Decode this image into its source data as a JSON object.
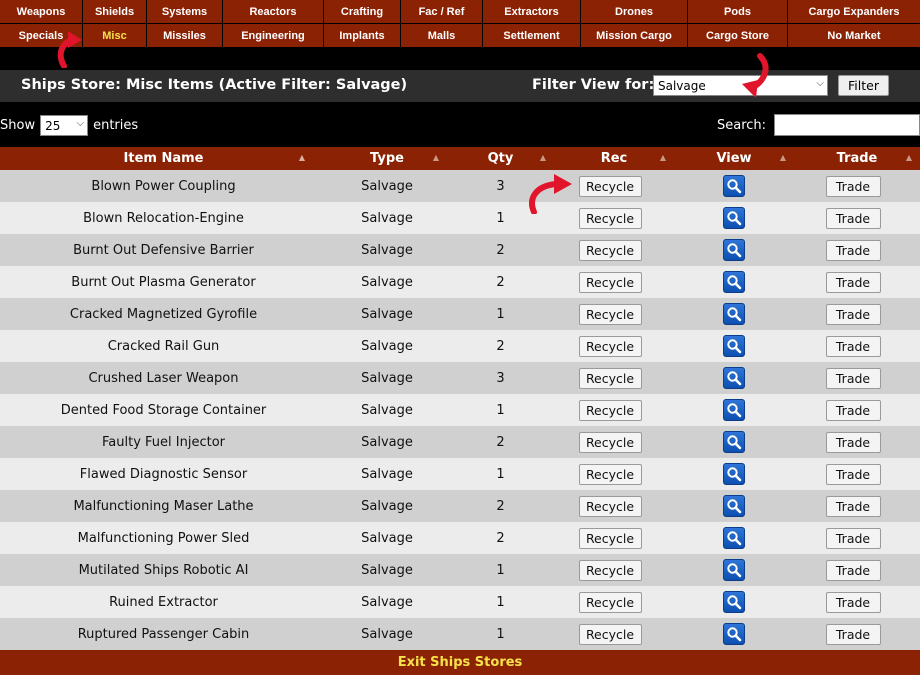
{
  "nav": {
    "row1": [
      "Weapons",
      "Shields",
      "Systems",
      "Reactors",
      "Crafting",
      "Fac / Ref",
      "Extractors",
      "Drones",
      "Pods",
      "Cargo Expanders"
    ],
    "row2": [
      "Specials",
      "Misc",
      "Missiles",
      "Engineering",
      "Implants",
      "Malls",
      "Settlement",
      "Mission Cargo",
      "Cargo Store",
      "No Market"
    ],
    "active_row2_index": 1
  },
  "header": {
    "title": "Ships Store: Misc Items (Active Filter: Salvage)",
    "filter_label": "Filter View for:",
    "filter_value": "Salvage",
    "filter_button": "Filter"
  },
  "controls": {
    "show_label": "Show",
    "show_value": "25",
    "entries_label": "entries",
    "search_label": "Search:",
    "search_value": ""
  },
  "table": {
    "headers": [
      "Item Name",
      "Type",
      "Qty",
      "Rec",
      "View",
      "Trade"
    ],
    "rec_label": "Recycle",
    "trade_label": "Trade",
    "rows": [
      {
        "name": "Blown Power Coupling",
        "type": "Salvage",
        "qty": "3"
      },
      {
        "name": "Blown Relocation-Engine",
        "type": "Salvage",
        "qty": "1"
      },
      {
        "name": "Burnt Out Defensive Barrier",
        "type": "Salvage",
        "qty": "2"
      },
      {
        "name": "Burnt Out Plasma Generator",
        "type": "Salvage",
        "qty": "2"
      },
      {
        "name": "Cracked Magnetized Gyrofile",
        "type": "Salvage",
        "qty": "1"
      },
      {
        "name": "Cracked Rail Gun",
        "type": "Salvage",
        "qty": "2"
      },
      {
        "name": "Crushed Laser Weapon",
        "type": "Salvage",
        "qty": "3"
      },
      {
        "name": "Dented Food Storage Container",
        "type": "Salvage",
        "qty": "1"
      },
      {
        "name": "Faulty Fuel Injector",
        "type": "Salvage",
        "qty": "2"
      },
      {
        "name": "Flawed Diagnostic Sensor",
        "type": "Salvage",
        "qty": "1"
      },
      {
        "name": "Malfunctioning Maser Lathe",
        "type": "Salvage",
        "qty": "2"
      },
      {
        "name": "Malfunctioning Power Sled",
        "type": "Salvage",
        "qty": "2"
      },
      {
        "name": "Mutilated Ships Robotic AI",
        "type": "Salvage",
        "qty": "1"
      },
      {
        "name": "Ruined Extractor",
        "type": "Salvage",
        "qty": "1"
      },
      {
        "name": "Ruptured Passenger Cabin",
        "type": "Salvage",
        "qty": "1"
      }
    ]
  },
  "footer": {
    "exit_label": "Exit Ships Stores"
  },
  "colors": {
    "nav_bg": "#8b2204",
    "nav_active": "#f6e24a",
    "titlebar_bg": "#2e2e2e",
    "row_odd": "#d0d0d0",
    "row_even": "#ececec",
    "annotation_arrow": "#e0142a"
  }
}
